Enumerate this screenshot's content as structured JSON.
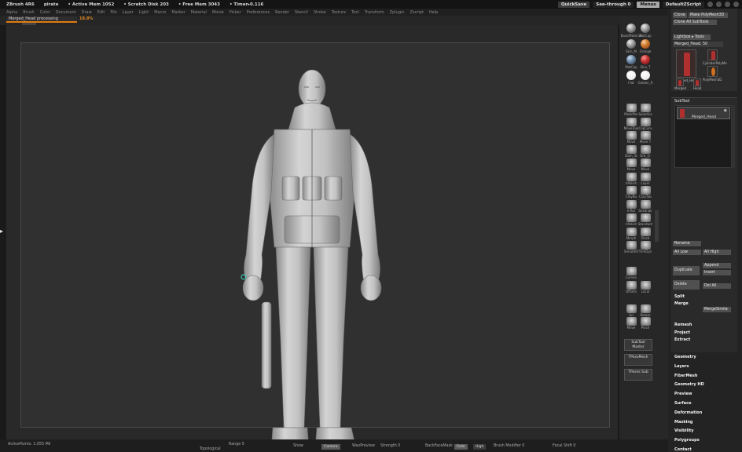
{
  "titlebar": {
    "app": "ZBrush 4R6",
    "doc": "pirate",
    "active_mem": "• Active Mem 1052",
    "scratch": "• Scratch Disk 203",
    "free_mem": "• Free Mem 3043",
    "timer": "• Timer▸0.116",
    "quicksave": "QuickSave",
    "see_through": "See-through   0",
    "menus": "Menus",
    "default_script": "DefaultZScript"
  },
  "menubar": [
    "Alpha",
    "Brush",
    "Color",
    "Document",
    "Draw",
    "Edit",
    "File",
    "Layer",
    "Light",
    "Macro",
    "Marker",
    "Material",
    "Movie",
    "Picker",
    "Preferences",
    "Render",
    "Stencil",
    "Stroke",
    "Texture",
    "Tool",
    "Transform",
    "Zplugin",
    "Zscript",
    "Help"
  ],
  "doctab": {
    "label": "Merged_Head processing",
    "percent": "18.8%"
  },
  "shelf": {
    "materials": [
      "BasicMaterial",
      "MatCap",
      "Skin_M",
      "Orange",
      "MatCap",
      "Skin_T",
      "Flat",
      "Golden_R"
    ],
    "brushes": [
      "MaskPen",
      "SelectLa",
      "MoveTool",
      "ClipCurv",
      "Move",
      "Move T",
      "Dam_St",
      "Orb_Cr",
      "Move",
      "Move",
      "hPolish",
      "Layer",
      "ClayBu",
      "ClayTub",
      "Inflat",
      "SnkSnak",
      "hPolish",
      "Standard",
      "Morph",
      "Pinch",
      "SmoothR",
      "TrimDyn"
    ],
    "brushes2": [
      "Curves"
    ],
    "tiles": [
      "Offsets",
      "Local"
    ],
    "transform": [
      "Scl",
      "Rotate",
      "Move",
      "Pinch"
    ],
    "subtool_master": "SubTool Master",
    "transpose": "TPoseMesh",
    "transpose_sub": "TPoses Sub"
  },
  "rpanel": {
    "buttons": [
      "Clone",
      "Make PolyMesh3D",
      "Clone All SubTools",
      "Lightbox ▸ Tools",
      "Merged_Head. 50"
    ],
    "tools": [
      "Merged_Head",
      "CylinderPolyMe",
      "PolyMesh3D",
      "Merged_Head_1",
      "Merged",
      "Head"
    ],
    "subtool_title": "SubTool",
    "subtool_item": "Merged_Head",
    "rename": "Rename",
    "all_low": "All Low",
    "all_high": "All High",
    "duplicate": "Duplicate",
    "append": "Append",
    "insert": "Insert",
    "delete": "Delete",
    "del_all": "Del All",
    "split": "Split",
    "merge": "Merge",
    "merge_similar": "MergeSimila",
    "remesh": "Remesh",
    "project": "Project",
    "extract": "Extract",
    "menus": [
      "Geometry",
      "Layers",
      "FiberMesh",
      "Geometry HD",
      "Preview",
      "Surface",
      "Deformation",
      "Masking",
      "Visibility",
      "Polygroups",
      "Contact"
    ]
  },
  "bottombar": {
    "active_points": "ActivePoints: 1.055 Mil",
    "topological": "Topological",
    "range": "Range 5",
    "show": "Show",
    "camera": "Camera",
    "wax": "WaxPreview",
    "strength": "Strength 0",
    "backface": "BackFaceMask",
    "fade": "Fade",
    "high": "High",
    "brush_modifier": "Brush Modifier 0",
    "focal": "Focal Shift 0"
  },
  "colors": {
    "accent": "#e07b12",
    "figure": "#b5b5b5",
    "bg": "#303030"
  }
}
